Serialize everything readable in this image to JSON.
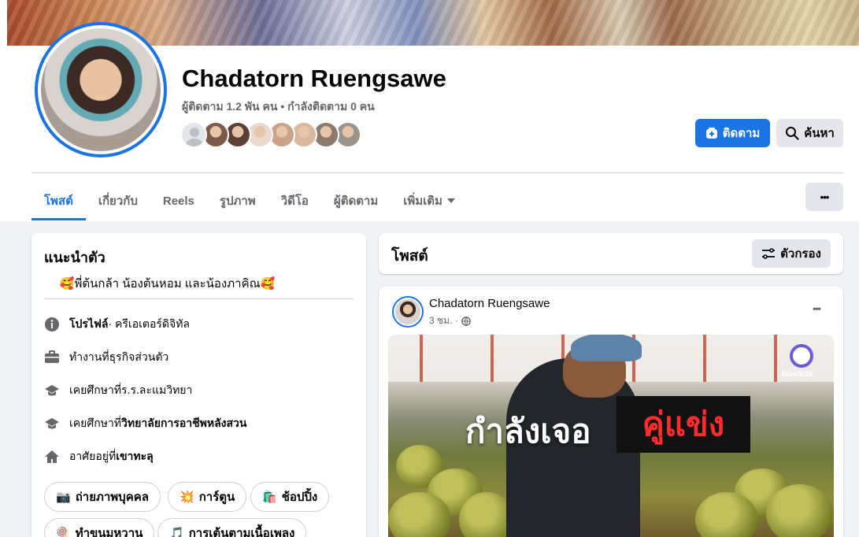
{
  "profile": {
    "name": "Chadatorn Ruengsawe",
    "stats": "ผู้ติดตาม 1.2 พัน คน • กำลังติดตาม 0 คน",
    "friend_colors": [
      "#e4e6eb",
      "#7a5a4a",
      "#5c4035",
      "#e8d8ce",
      "#c9a38a",
      "#d7b9a0",
      "#8a7b6c",
      "#9a948c"
    ]
  },
  "actions": {
    "follow_label": "ติดตาม",
    "search_label": "ค้นหา",
    "more_label": "•••"
  },
  "tabs": [
    {
      "label": "โพสต์"
    },
    {
      "label": "เกี่ยวกับ"
    },
    {
      "label": "Reels"
    },
    {
      "label": "รูปภาพ"
    },
    {
      "label": "วิดีโอ"
    },
    {
      "label": "ผู้ติดตาม"
    },
    {
      "label": "เพิ่มเติม"
    }
  ],
  "intro": {
    "title": "แนะนำตัว",
    "bio": "🥰พี่ต้นกล้า น้องต้นหอม และน้องภาคิณ🥰",
    "rows": [
      {
        "icon": "info-icon",
        "prefix": "โปรไฟล์",
        "value": " · ครีเอเตอร์ดิจิทัล"
      },
      {
        "icon": "briefcase-icon",
        "prefix": "ทำงานที่ ",
        "value": "ธุรกิจส่วนตัว"
      },
      {
        "icon": "graduation-cap-icon",
        "prefix": "เคยศึกษาที่ ",
        "value": "ร.ร.ละแมวิทยา"
      },
      {
        "icon": "graduation-cap-icon",
        "prefix": "เคยศึกษาที่ ",
        "value": "วิทยาลัยการอาชีพหลังสวน"
      },
      {
        "icon": "home-icon",
        "prefix": "อาศัยอยู่ที่ ",
        "value": "เขาทะลุ"
      }
    ],
    "chips": [
      {
        "emoji": "📷",
        "label": "ถ่ายภาพบุคคล"
      },
      {
        "emoji": "💥",
        "label": "การ์ตูน"
      },
      {
        "emoji": "🛍️",
        "label": "ช้อปปิ้ง"
      },
      {
        "emoji": "🍭",
        "label": "ทำขนมหวาน"
      },
      {
        "emoji": "🎵",
        "label": "การเต้นตามเนื้อเพลง"
      }
    ]
  },
  "posts": {
    "title": "โพสต์",
    "filter_label": "ตัวกรอง",
    "post": {
      "author": "Chadatorn Ruengsawe",
      "time": "3 ชม. ·",
      "more_label": "•••",
      "media_caption_white": "กำลังเจอ",
      "media_caption_red": "คู่แข่ง",
      "media_logo": "Blockdit"
    }
  }
}
